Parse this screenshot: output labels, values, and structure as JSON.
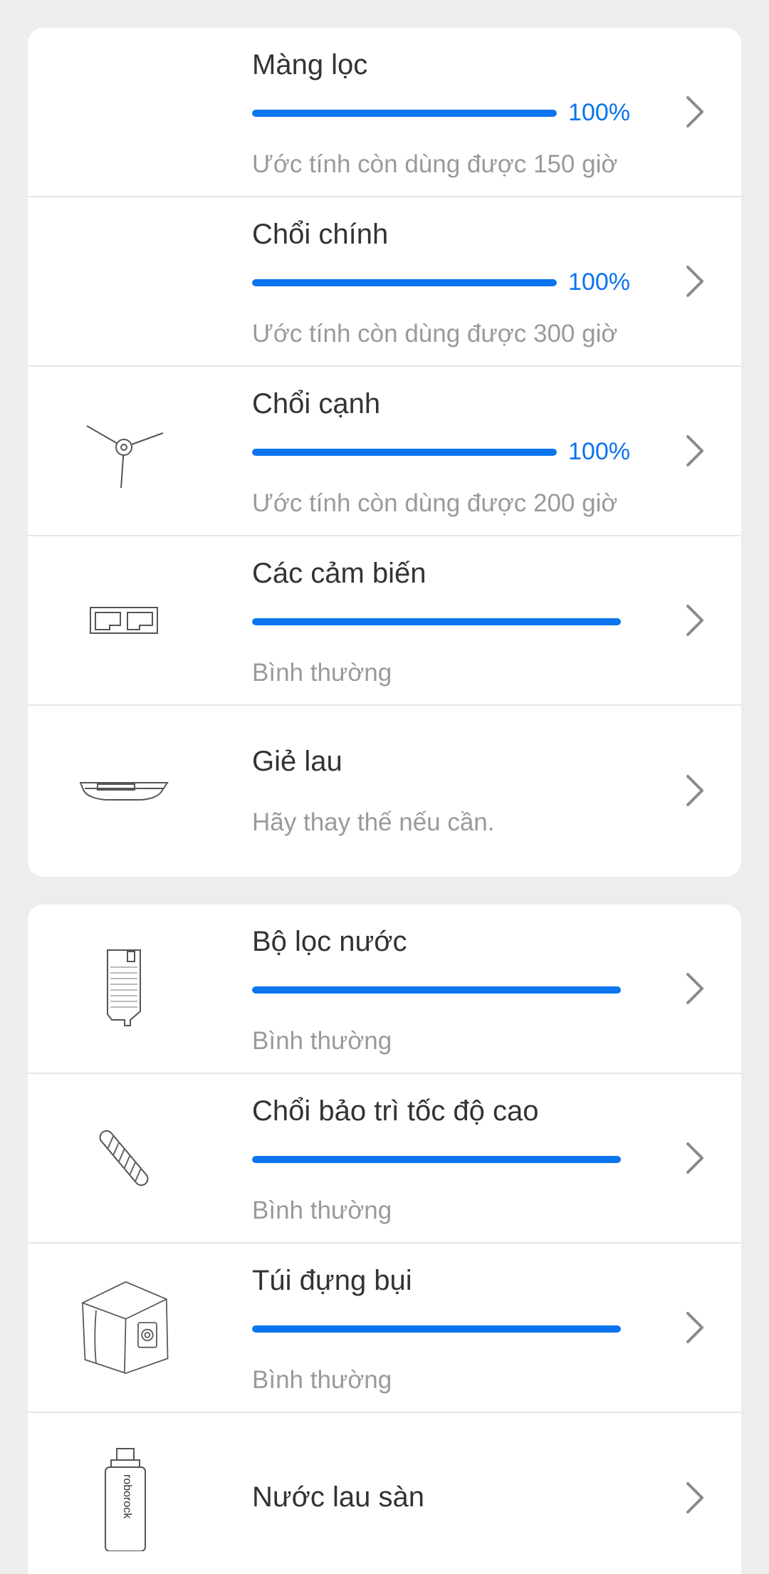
{
  "sections": [
    {
      "items": [
        {
          "title": "Màng lọc",
          "percent_label": "100%",
          "level": 1.0,
          "subtitle": "Ước tính còn dùng được 150 giờ",
          "icon": "filter-icon"
        },
        {
          "title": "Chổi chính",
          "percent_label": "100%",
          "level": 1.0,
          "subtitle": "Ước tính còn dùng được 300 giờ",
          "icon": "main-brush-icon"
        },
        {
          "title": "Chổi cạnh",
          "percent_label": "100%",
          "level": 1.0,
          "subtitle": "Ước tính còn dùng được 200 giờ",
          "icon": "side-brush-icon"
        },
        {
          "title": "Các cảm biến",
          "level": 1.0,
          "subtitle": "Bình thường",
          "icon": "sensor-icon"
        },
        {
          "title": "Giẻ lau",
          "subtitle": "Hãy thay thế nếu cần.",
          "icon": "mop-cloth-icon"
        }
      ]
    },
    {
      "items": [
        {
          "title": "Bộ lọc nước",
          "level": 1.0,
          "subtitle": "Bình thường",
          "icon": "water-filter-icon"
        },
        {
          "title": "Chổi bảo trì tốc độ cao",
          "level": 1.0,
          "subtitle": "Bình thường",
          "icon": "maintenance-brush-icon"
        },
        {
          "title": "Túi đựng bụi",
          "level": 1.0,
          "subtitle": "Bình thường",
          "icon": "dust-bag-icon"
        },
        {
          "title": "Nước lau sàn",
          "icon": "floor-cleaner-bottle-icon",
          "bottle_label": "roborock"
        }
      ]
    }
  ],
  "colors": {
    "accent": "#0b74ee",
    "track": "#e3e3e3",
    "text": "#333333",
    "subtext": "#9a9a9a",
    "background": "#ededed"
  }
}
